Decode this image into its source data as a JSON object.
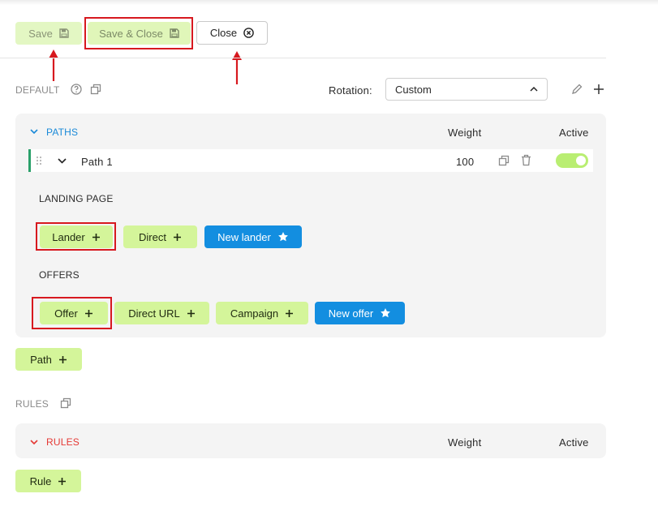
{
  "toolbar": {
    "save_label": "Save",
    "save_close_label": "Save & Close",
    "close_label": "Close"
  },
  "default_section": {
    "label": "DEFAULT",
    "rotation_label": "Rotation:",
    "rotation_value": "Custom"
  },
  "paths": {
    "title": "PATHS",
    "weight_header": "Weight",
    "active_header": "Active",
    "rows": [
      {
        "name": "Path 1",
        "weight": "100",
        "active": true
      }
    ],
    "landing_page_label": "LANDING PAGE",
    "landing_buttons": {
      "lander": "Lander",
      "direct": "Direct",
      "new_lander": "New lander"
    },
    "offers_label": "OFFERS",
    "offer_buttons": {
      "offer": "Offer",
      "direct_url": "Direct URL",
      "campaign": "Campaign",
      "new_offer": "New offer"
    },
    "add_path_label": "Path"
  },
  "rules_section": {
    "label": "RULES",
    "title": "RULES",
    "weight_header": "Weight",
    "active_header": "Active",
    "add_rule_label": "Rule"
  },
  "colors": {
    "accent_green": "#d4f59a",
    "accent_blue": "#138ee0",
    "highlight_red": "#d7191f",
    "path_bar_green": "#2aa06a",
    "rules_red": "#e53935"
  },
  "icons": [
    "save-icon",
    "close-circle-icon",
    "help-icon",
    "copy-icon",
    "chevron-up-icon",
    "pencil-icon",
    "plus-icon",
    "chevron-down-icon",
    "drag-handle-icon",
    "trash-icon",
    "star-icon"
  ]
}
